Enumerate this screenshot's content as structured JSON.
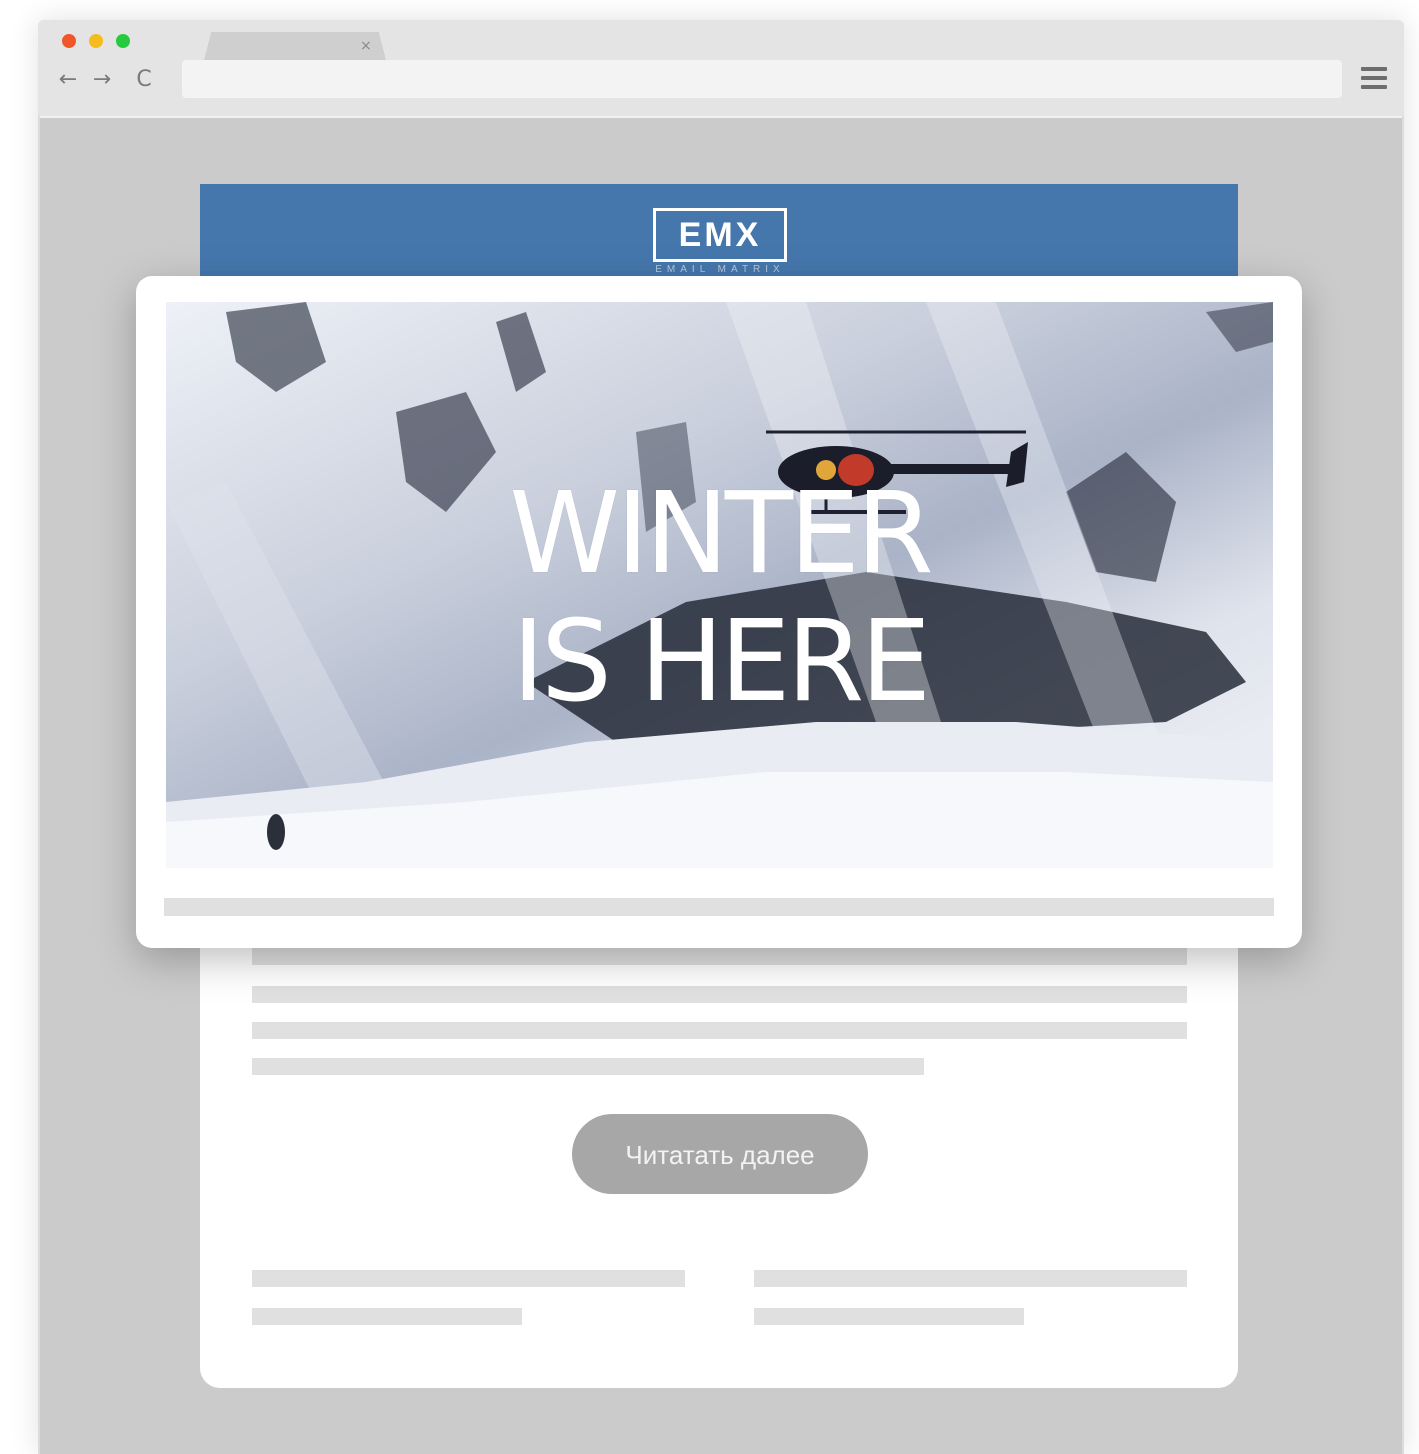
{
  "browser": {
    "tab_close": "×",
    "nav": {
      "back": "←",
      "forward": "→",
      "reload": "C"
    }
  },
  "email": {
    "logo": "EMX",
    "logo_sub": "EMAIL MATRIX",
    "hero_line1": "WINTER",
    "hero_line2": "IS HERE",
    "cta_label": "Читатать далее",
    "header_color": "#4577ad"
  },
  "icons": [
    "close-icon",
    "arrow-left-icon",
    "arrow-right-icon",
    "reload-icon",
    "hamburger-menu-icon"
  ]
}
